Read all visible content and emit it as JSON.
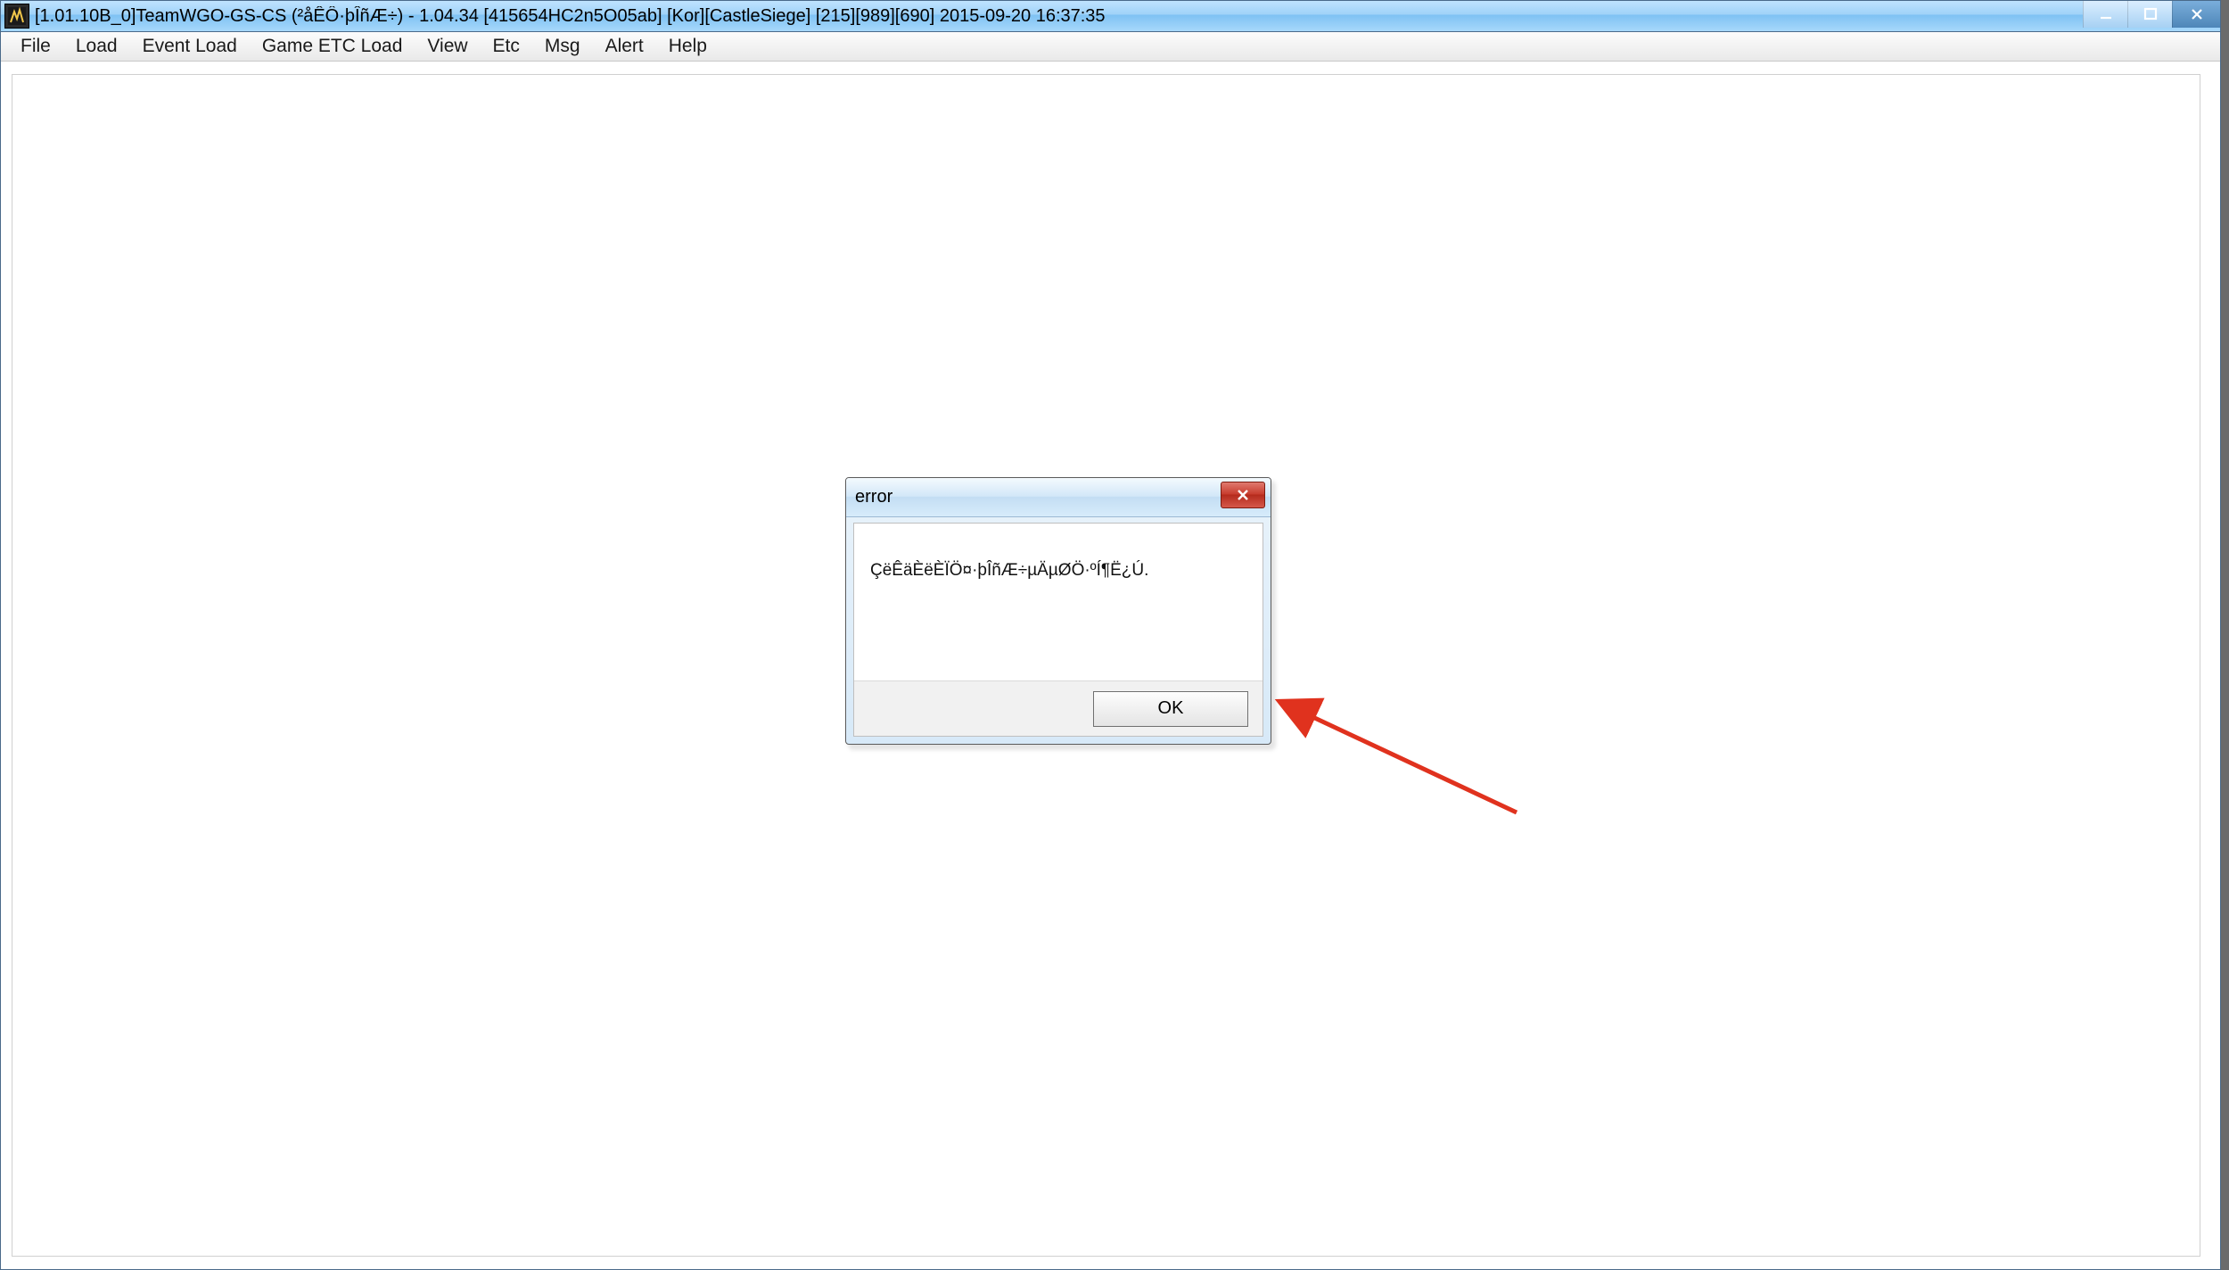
{
  "window": {
    "title": "[1.01.10B_0]TeamWGO-GS-CS (²åÊÔ·þÎñÆ÷) - 1.04.34 [415654HC2n5O05ab] [Kor][CastleSiege] [215][989][690] 2015-09-20 16:37:35"
  },
  "menubar": {
    "items": [
      "File",
      "Load",
      "Event Load",
      "Game ETC Load",
      "View",
      "Etc",
      "Msg",
      "Alert",
      "Help"
    ]
  },
  "dialog": {
    "title": "error",
    "message": "ÇëÊäÈëÈÏÖ¤·þÎñÆ÷µÄµØÖ·ºÍ¶Ë¿Ú.",
    "ok_label": "OK"
  },
  "icons": {
    "app": "app-icon",
    "minimize": "minimize-icon",
    "maximize": "maximize-icon",
    "close": "close-icon",
    "dialog_close": "close-icon"
  },
  "annotation": {
    "arrow_color": "#e0321e"
  }
}
